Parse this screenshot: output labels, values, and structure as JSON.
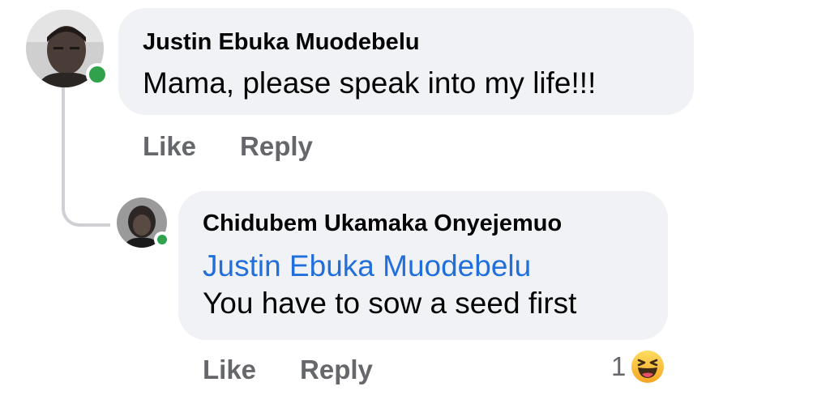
{
  "comment": {
    "author": "Justin Ebuka Muodebelu",
    "text": "Mama, please speak into my life!!!",
    "actions": {
      "like": "Like",
      "reply": "Reply"
    },
    "online": true
  },
  "reply": {
    "author": "Chidubem Ukamaka Onyejemuo",
    "mention": "Justin Ebuka Muodebelu",
    "text": "You have to sow a seed first",
    "actions": {
      "like": "Like",
      "reply": "Reply"
    },
    "reaction_count": "1",
    "reaction_icon": "laughing-emoji-icon",
    "online": true
  },
  "colors": {
    "bubble": "#f0f2f5",
    "mention": "#216fdb",
    "action_text": "#65676b",
    "online": "#31a24c"
  }
}
